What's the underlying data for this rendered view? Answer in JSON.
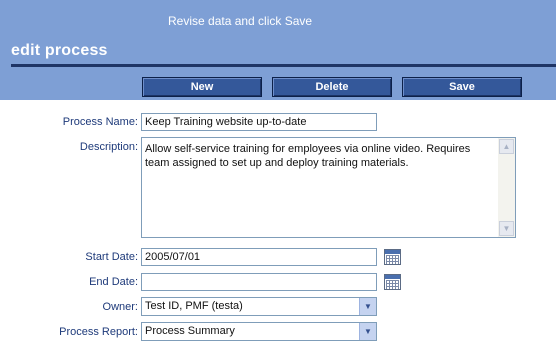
{
  "header": {
    "instruction": "Revise data and click Save",
    "title": "edit process"
  },
  "toolbar": {
    "new_label": "New",
    "delete_label": "Delete",
    "save_label": "Save"
  },
  "form": {
    "process_name": {
      "label": "Process Name:",
      "value": "Keep Training website up-to-date"
    },
    "description": {
      "label": "Description:",
      "value": "Allow self-service training for employees via online video. Requires team assigned to set up and deploy training materials."
    },
    "start_date": {
      "label": "Start Date:",
      "value": "2005/07/01"
    },
    "end_date": {
      "label": "End Date:",
      "value": ""
    },
    "owner": {
      "label": "Owner:",
      "selected": "Test ID, PMF (testa)"
    },
    "process_report": {
      "label": "Process Report:",
      "selected": "Process Summary"
    }
  },
  "icons": {
    "calendar": "calendar-icon",
    "dropdown": "chevron-down-icon",
    "scroll_up": "scroll-up-arrow",
    "scroll_down": "scroll-down-arrow"
  },
  "colors": {
    "header_bg": "#7e9fd5",
    "title_rule": "#1f3566",
    "button_bg": "#34589a",
    "label_text": "#1e3a7a",
    "field_border": "#7f9db9"
  }
}
